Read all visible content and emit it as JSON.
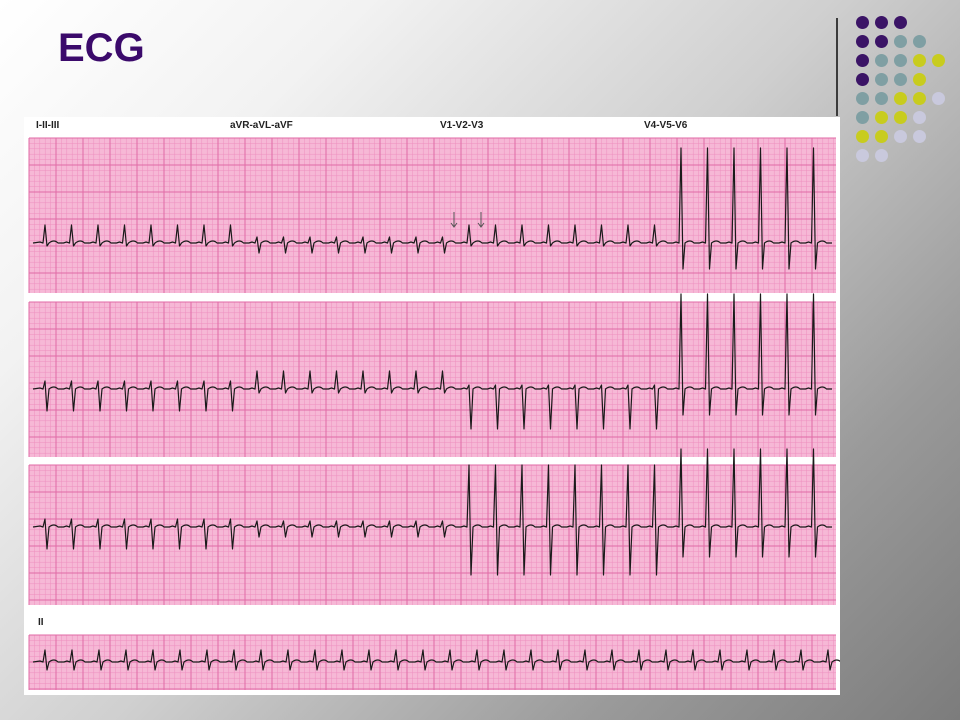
{
  "slide": {
    "title": "ECG"
  },
  "ecg": {
    "lead_groups": [
      {
        "label": "I-II-III"
      },
      {
        "label": "aVR-aVL-aVF"
      },
      {
        "label": "V1-V2-V3"
      },
      {
        "label": "V4-V5-V6"
      }
    ],
    "rhythm_label": "II"
  },
  "colors": {
    "title": "#3b0a6b",
    "grid_paper": "#f6b8d6",
    "grid_minor": "#ee8fbf",
    "grid_major": "#e06aa6",
    "trace": "#1a1a1a",
    "decor_purple": "#3b1466",
    "decor_teal": "#7f9fa3",
    "decor_yellow": "#c8cc1e",
    "decor_lavender": "#c9c9dd"
  },
  "decoration": {
    "dot_grid": [
      [
        "purple",
        "purple",
        "purple",
        "",
        "",
        ""
      ],
      [
        "purple",
        "purple",
        "teal",
        "teal",
        "",
        ""
      ],
      [
        "purple",
        "teal",
        "teal",
        "yellow",
        "yellow",
        ""
      ],
      [
        "purple",
        "teal",
        "teal",
        "yellow",
        "",
        ""
      ],
      [
        "teal",
        "teal",
        "yellow",
        "yellow",
        "lavender",
        ""
      ],
      [
        "teal",
        "yellow",
        "yellow",
        "lavender",
        "",
        ""
      ],
      [
        "yellow",
        "yellow",
        "lavender",
        "lavender",
        "",
        ""
      ],
      [
        "lavender",
        "lavender",
        "",
        "",
        "",
        ""
      ]
    ]
  }
}
